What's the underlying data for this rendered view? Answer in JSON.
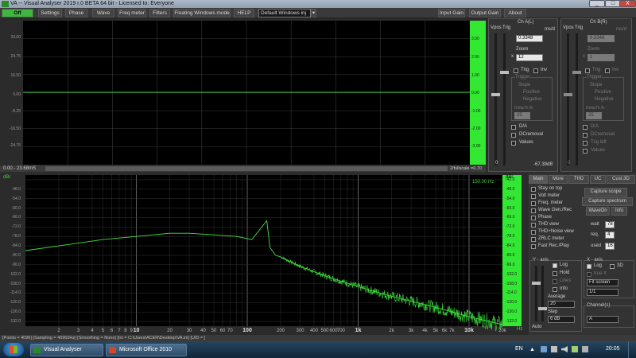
{
  "window": {
    "title": "VA -- Visual Analyser 2019 r.0 BETA 64 bit - Licensed to: Everyone",
    "min": "_",
    "max": "□",
    "close": "X"
  },
  "menu": {
    "off": "Off",
    "settings": "Settings",
    "phase": "Phase",
    "wave": "Wave",
    "freq_meter": "Freq meter",
    "filters": "Filters",
    "floating": "Floating Windows mode",
    "help": "HELP",
    "dropdown": "Default Windows inj",
    "input_gain": "Input Gain",
    "output_gain": "Output Gain",
    "about": "About"
  },
  "scope": {
    "y_left": [
      "33.00",
      "24.75",
      "16.50",
      "8.25",
      "0.00",
      "-8.25",
      "-16.50",
      "-24.75",
      "-33.00"
    ],
    "y_right": [
      "4.00",
      "3.00",
      "2.00",
      "1.00",
      "0.00",
      "-1.00",
      "-2.00",
      "-3.00",
      "-4.00"
    ],
    "time_range": "0.00 - 23.68mS",
    "fullscale": "2/fullscale =0.70"
  },
  "chA": {
    "title": "Ch A(L)",
    "vpos": "Vpos",
    "trig_lbl": "Trig",
    "ms_div_label": "ms/d",
    "ms_div": "0.3348",
    "zoom_label": "Zoom",
    "x": "x",
    "zoom": "12",
    "trig": "Trig",
    "inv": "Inv",
    "trigger": "Trigger",
    "slope": "Slope",
    "positive": "Positive",
    "negative": "Negative",
    "delta_label": "DeltaTh.%",
    "delta": "25",
    "da": "D/A",
    "dc_removal": "DCremoval",
    "values": "Values",
    "zero": "0",
    "readout": "-67.39dB"
  },
  "chB": {
    "title": "Ch B(R)",
    "vpos": "Vpos",
    "trig_lbl": "Trig",
    "ms_div_label": "ms/d",
    "ms_div": "0.3348",
    "zoom_label": "Zoom",
    "x": "x",
    "zoom": "1",
    "trig": "Trig",
    "inv": "Inv",
    "trigger": "Trigger",
    "slope": "Slope",
    "positive": "Positive",
    "negative": "Negative",
    "delta_label": "DeltaTh.%",
    "delta": "25",
    "da": "D/A",
    "dc_removal": "DCremoval",
    "trig_left": "Trig left",
    "values": "Values",
    "zero": "0"
  },
  "spectrum": {
    "unit_left": "dBr",
    "unit_right": "dBr",
    "marker": "150.00 Hz",
    "hz": "Hz",
    "y_left": [
      "-3.0",
      "-12.0",
      "-18.0",
      "-24.0",
      "-30.0",
      "-36.0",
      "-42.0",
      "-48.0",
      "-54.0",
      "-60.0",
      "-66.0",
      "-72.0",
      "-78.0",
      "-84.0",
      "-90.0",
      "-96.0",
      "-102.0",
      "-108.0",
      "-114.0",
      "-120.0",
      "-126.0",
      "-132.0"
    ],
    "y_right": [
      "-42.0",
      "-48.0",
      "-54.0",
      "-60.0",
      "-66.0",
      "-72.0",
      "-78.0",
      "-84.0",
      "-90.0",
      "-96.0",
      "-102.0",
      "-108.0",
      "-114.0",
      "-120.0",
      "-126.0",
      "-132.0"
    ],
    "x_ticks": [
      "2",
      "3",
      "4",
      "5",
      "6",
      "7",
      "8",
      "9",
      "10",
      "20",
      "30",
      "40",
      "50",
      "60",
      "70",
      "100",
      "200",
      "300",
      "400",
      "500",
      "600",
      "700",
      "1k",
      "2k",
      "3k",
      "4k",
      "5k",
      "6k",
      "7k",
      "10k",
      "20k"
    ]
  },
  "chart_data": {
    "type": "line",
    "x_scale": "log",
    "xlim": [
      1,
      20000
    ],
    "ylim": [
      -135,
      -39
    ],
    "series": [
      {
        "x": [
          1,
          2,
          5,
          10,
          20,
          30,
          50,
          80,
          110,
          150,
          160,
          180,
          200,
          300,
          500,
          1000,
          2000,
          5000,
          10000,
          20000
        ],
        "y": [
          -87,
          -84,
          -80,
          -78,
          -76,
          -76,
          -77,
          -78,
          -80,
          -68,
          -85,
          -90,
          -91,
          -97,
          -103,
          -110,
          -116,
          -123,
          -129,
          -134
        ]
      }
    ]
  },
  "tabs": {
    "main": "Main",
    "more": "More",
    "thd": "THD",
    "uc": "UC",
    "cust3d": "Cust.3D"
  },
  "panel": {
    "stay_on_top": "Stay on top",
    "volt_meter": "Volt meter",
    "freq_meter": "Freq. meter",
    "wave_gen": "Wave Gen./Rec",
    "phase": "Phase",
    "thd_view": "THD view",
    "thd_noise": "THD+Noise view",
    "zrlc": "ZRLC meter",
    "fast_rec": "Fast Rec./Play",
    "capture_scope": "Capture scope",
    "capture_spectrum": "Capture spectrum",
    "wave_on": "WaveOn",
    "info": "Info",
    "wait_lbl": "wait",
    "wait": "78",
    "req_lbl": "req.",
    "req": "4",
    "used_lbl": "used",
    "used": "16",
    "y_axis": "Y - axis",
    "log": "Log",
    "hold": "Hold",
    "lines": "Lines",
    "y_info": "Info",
    "average": "Average",
    "average_val": "20",
    "step": "Step",
    "step_val": "6 dB",
    "auto": "Auto",
    "x_axis": "X - axis",
    "x_log": "Log",
    "d3": "3D",
    "true_x": "true X",
    "fit_screen": "Fit screen",
    "ratio": "1/1",
    "channels": "Channel(s)",
    "channel_val": "A"
  },
  "status": {
    "text": "[Points = 4096]  [Sampling = 40960Hz]  [Smoothing = None]  [Ini = C:\\Users\\ACER\\Desktop\\VA.ini]  [UID = ]"
  },
  "taskbar": {
    "app1": "Visual Analyser",
    "app2": "Microsoft Office 2010",
    "lang": "EN",
    "time": "20:05"
  }
}
